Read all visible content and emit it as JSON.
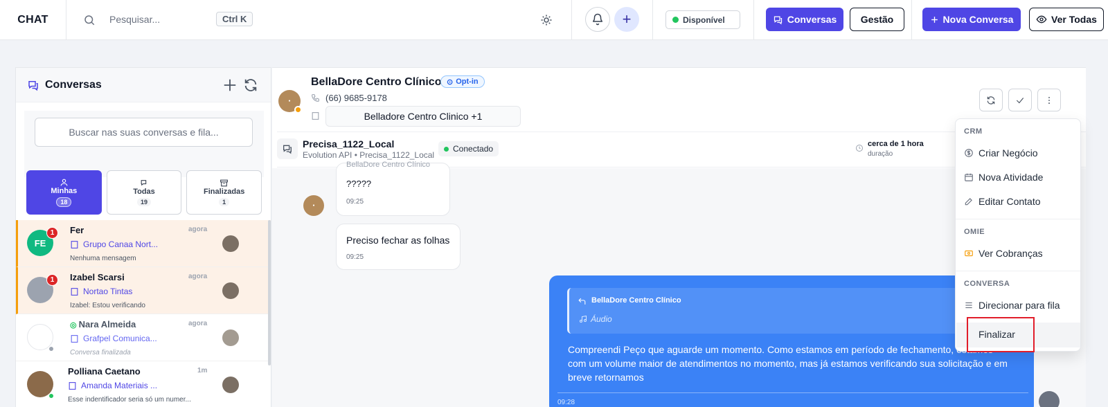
{
  "topbar": {
    "brand": "CHAT",
    "search_placeholder": "Pesquisar...",
    "shortcut": "Ctrl K",
    "status": "Disponível",
    "btn_conversas": "Conversas",
    "btn_gestao": "Gestão",
    "btn_nova": "Nova Conversa",
    "btn_ver_todas": "Ver Todas"
  },
  "sidebar": {
    "title": "Conversas",
    "search_placeholder": "Buscar nas suas conversas e fila...",
    "tabs": [
      {
        "label": "Minhas",
        "count": "18"
      },
      {
        "label": "Todas",
        "count": "19"
      },
      {
        "label": "Finalizadas",
        "count": "1"
      }
    ],
    "conversations": [
      {
        "initials": "FE",
        "name": "Fer",
        "time": "agora",
        "org": "Grupo Canaa Nort...",
        "message": "Nenhuma mensagem",
        "unread": "1"
      },
      {
        "initials": "",
        "name": "Izabel Scarsi",
        "time": "agora",
        "org": "Nortao Tintas",
        "message": "Izabel: Estou verificando",
        "unread": "1"
      },
      {
        "initials": "",
        "name": "Nara Almeida",
        "time": "agora",
        "org": "Grafpel Comunica...",
        "message": "Conversa finalizada",
        "unread": ""
      },
      {
        "initials": "",
        "name": "Polliana Caetano",
        "time": "1m",
        "org": "Amanda Materiais ...",
        "message": "Esse indentificador seria só um numer...",
        "unread": ""
      }
    ]
  },
  "chat": {
    "contact_name": "BellaDore Centro Clínico",
    "optin": "Opt-in",
    "phone": "(66) 9685-9178",
    "organization": "Belladore Centro Clinico +1",
    "channel_name": "Precisa_1122_Local",
    "channel_sub": "Evolution API • Precisa_1122_Local",
    "channel_status": "Conectado",
    "duration_value": "cerca de 1 hora",
    "duration_label": "duração",
    "messages": [
      {
        "sender_cut": "BellaDore Centro Clínico",
        "text": "?????",
        "time": "09:25"
      },
      {
        "text": "Preciso fechar as folhas",
        "time": "09:25"
      }
    ],
    "outgoing": {
      "quote_name": "BellaDore Centro Clínico",
      "quote_text": "Áudio",
      "text": "Compreendi Peço que aguarde um momento. Como estamos em período de fechamento, estamos com um volume maior de atendimentos no momento, mas já estamos verificando sua solicitação e em breve retornamos",
      "time": "09:28"
    }
  },
  "menu": {
    "crm": "CRM",
    "criar_negocio": "Criar Negócio",
    "nova_atividade": "Nova Atividade",
    "editar_contato": "Editar Contato",
    "omie": "OMIE",
    "ver_cobrancas": "Ver Cobranças",
    "conversa": "CONVERSA",
    "direcionar": "Direcionar para fila",
    "finalizar": "Finalizar"
  },
  "colors": {
    "primary": "#4f46e5",
    "bubble_out": "#3b82f6",
    "online": "#22c55e",
    "unread_bg": "#fdf1e7",
    "highlight": "#e11d2a"
  }
}
